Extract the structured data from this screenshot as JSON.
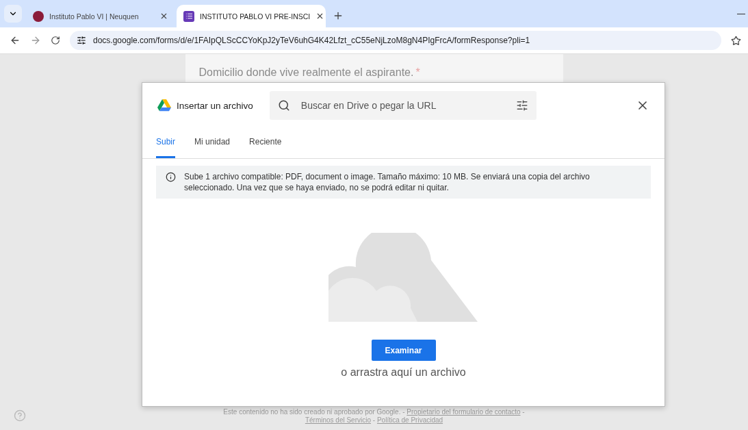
{
  "browser": {
    "tabs": [
      {
        "title": "Instituto Pablo VI | Neuquen",
        "selected": false
      },
      {
        "title": "INSTITUTO PABLO VI PRE-INSCI",
        "selected": true
      }
    ],
    "url": "docs.google.com/forms/d/e/1FAIpQLScCCYoKpJ2yTeV6uhG4K42Lfzt_cC55eNjLzoM8gN4PIgFrcA/formResponse?pli=1"
  },
  "form": {
    "question": "Domicilio donde vive realmente el aspirante.",
    "required_mark": "*"
  },
  "dialog": {
    "title": "Insertar un archivo",
    "search": {
      "placeholder": "Buscar en Drive o pegar la URL"
    },
    "tabs": [
      {
        "label": "Subir",
        "selected": true
      },
      {
        "label": "Mi unidad",
        "selected": false
      },
      {
        "label": "Reciente",
        "selected": false
      }
    ],
    "notice": "Sube 1 archivo compatible: PDF, document o image. Tamaño máximo: 10 MB. Se enviará una copia del archivo seleccionado. Una vez que se haya enviado, no se podrá editar ni quitar.",
    "browse_button": "Examinar",
    "drop_hint": "o arrastra aquí un archivo"
  },
  "footer": {
    "disclaimer": "Este contenido no ha sido creado ni aprobado por Google.",
    "separator": "-",
    "links": [
      "Propietario del formulario de contacto",
      "Términos del Servicio",
      "Política de Privacidad"
    ]
  }
}
